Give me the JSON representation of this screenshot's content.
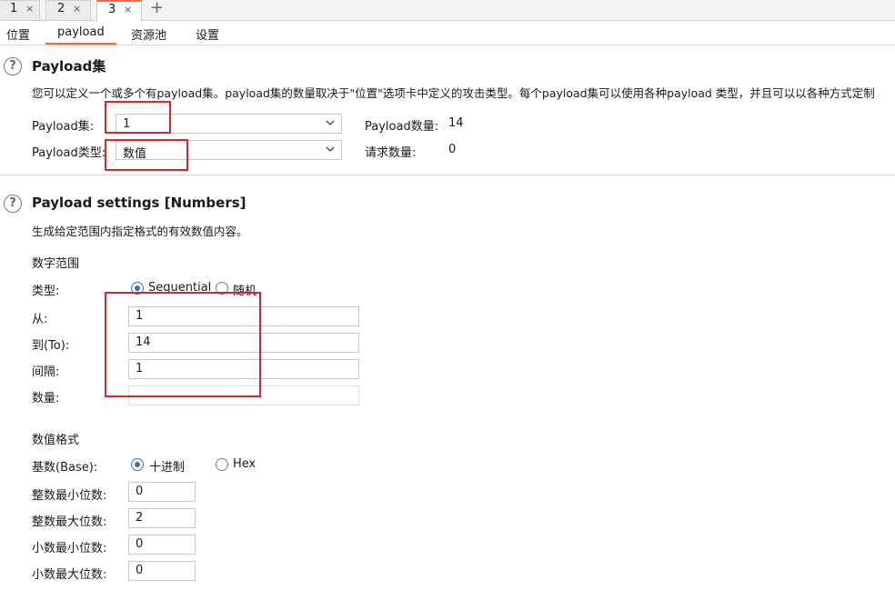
{
  "attack_tabs": [
    {
      "label": "1",
      "close": "×"
    },
    {
      "label": "2",
      "close": "×"
    },
    {
      "label": "3",
      "close": "×"
    }
  ],
  "add_tab": "+",
  "sub_tabs": [
    "位置",
    "payload",
    "资源池",
    "设置"
  ],
  "active_sub_tab": "payload",
  "accent_color": "#ff6633",
  "highlight_color": "#e0232b",
  "payload_sets": {
    "title": "Payload集",
    "description": "您可以定义一个或多个有payload集。payload集的数量取决于\"位置\"选项卡中定义的攻击类型。每个payload集可以使用各种payload 类型，并且可以以各种方式定制",
    "set_label": "Payload集:",
    "set_value": "1",
    "type_label": "Payload类型:",
    "type_value": "数值",
    "count_label": "Payload数量:",
    "count_value": "14",
    "requests_label": "请求数量:",
    "requests_value": "0"
  },
  "payload_settings": {
    "title": "Payload settings [Numbers]",
    "description": "生成给定范围内指定格式的有效数值内容。",
    "range_heading": "数字范围",
    "type_label": "类型:",
    "sequential_label": "Sequential",
    "random_label": "随机",
    "type_selected": "Sequential",
    "from_label": "从:",
    "from_value": "1",
    "to_label": "到(To):",
    "to_value": "14",
    "step_label": "间隔:",
    "step_value": "1",
    "howmany_label": "数量:",
    "howmany_value": "",
    "format_heading": "数值格式",
    "base_label": "基数(Base):",
    "decimal_label": "十进制",
    "hex_label": "Hex",
    "base_selected": "十进制",
    "min_int_label": "整数最小位数:",
    "min_int_value": "0",
    "max_int_label": "整数最大位数:",
    "max_int_value": "2",
    "min_frac_label": "小数最小位数:",
    "min_frac_value": "0",
    "max_frac_label": "小数最大位数:",
    "max_frac_value": "0"
  },
  "icons": {
    "help": "question-circle-icon",
    "dropdown": "chevron-down-icon",
    "close": "close-icon",
    "add": "plus-icon"
  }
}
